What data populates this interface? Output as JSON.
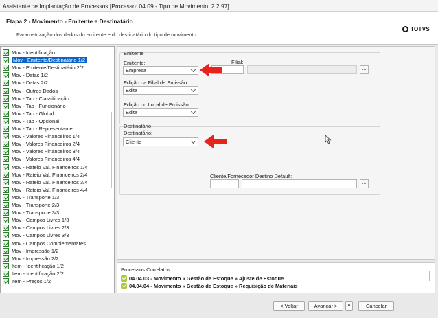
{
  "window": {
    "title": "Assistente de Implantação de Processos [Processo: 04.09 - Tipo de Movimento: 2.2.97]"
  },
  "header": {
    "step_title": "Etapa 2 - Movimento - Emitente e Destinatário",
    "step_description": "Parametrização dos dados do emitente e do destinatário do tipo de movimento.",
    "logo_text": "TOTVS"
  },
  "tree": {
    "items": [
      "Mov - Identificação",
      "Mov - Emitente/Destinatário 1/2",
      "Mov - Emitente/Destinatário 2/2",
      "Mov - Datas 1/2",
      "Mov - Datas 2/2",
      "Mov - Outros Dados",
      "Mov - Tab - Classificação",
      "Mov - Tab - Funcionário",
      "Mov - Tab - Global",
      "Mov - Tab - Opcional",
      "Mov - Tab - Representante",
      "Mov - Valores Financeiros 1/4",
      "Mov - Valores Financeiros 2/4",
      "Mov - Valores Financeiros 3/4",
      "Mov - Valores Financeiros 4/4",
      "Mov - Rateio Val. Financeiros 1/4",
      "Mov - Rateio Val. Financeiros 2/4",
      "Mov - Rateio Val. Financeiros 3/4",
      "Mov - Rateio Val. Financeiros 4/4",
      "Mov - Transporte 1/3",
      "Mov - Transporte 2/3",
      "Mov - Transporte 3/3",
      "Mov - Campos Livres 1/3",
      "Mov - Campos Livres 2/3",
      "Mov - Campos Livres 3/3",
      "Mov - Campos Complementares",
      "Mov - Impressão 1/2",
      "Mov - Impressão 2/2",
      "Item - Identificação 1/2",
      "Item - Identificação 2/2",
      "Item - Preços 1/2"
    ],
    "selected_index": 1
  },
  "emitente": {
    "group_label": "Emitente",
    "emitente_label": "Emitente:",
    "emitente_value": "Empresa",
    "filial_label": "Filial:",
    "edicao_filial_label": "Edição da Filial de Emissão:",
    "edicao_filial_value": "Edita",
    "edicao_local_label": "Edição do Local de Emissão:",
    "edicao_local_value": "Edita",
    "lookup_label": "..."
  },
  "destinatario": {
    "group_label": "Destinatário",
    "destinatario_label": "Destinatário:",
    "destinatario_value": "Cliente",
    "cliente_default_label": "Cliente/Fornecedor Destino Default:",
    "lookup_label": "..."
  },
  "related": {
    "title": "Processos Correlatos",
    "items": [
      "04.04.03 - Movimento » Gestão de Estoque » Ajuste de Estoque",
      "04.04.04 - Movimento » Gestão de Estoque » Requisição de Materiais"
    ]
  },
  "footer": {
    "back_label": "< Voltar",
    "next_label": "Avançar >",
    "next_menu_label": "▾",
    "cancel_label": "Cancelar"
  },
  "colors": {
    "selection": "#0a64c8",
    "arrow": "#e8231b"
  }
}
